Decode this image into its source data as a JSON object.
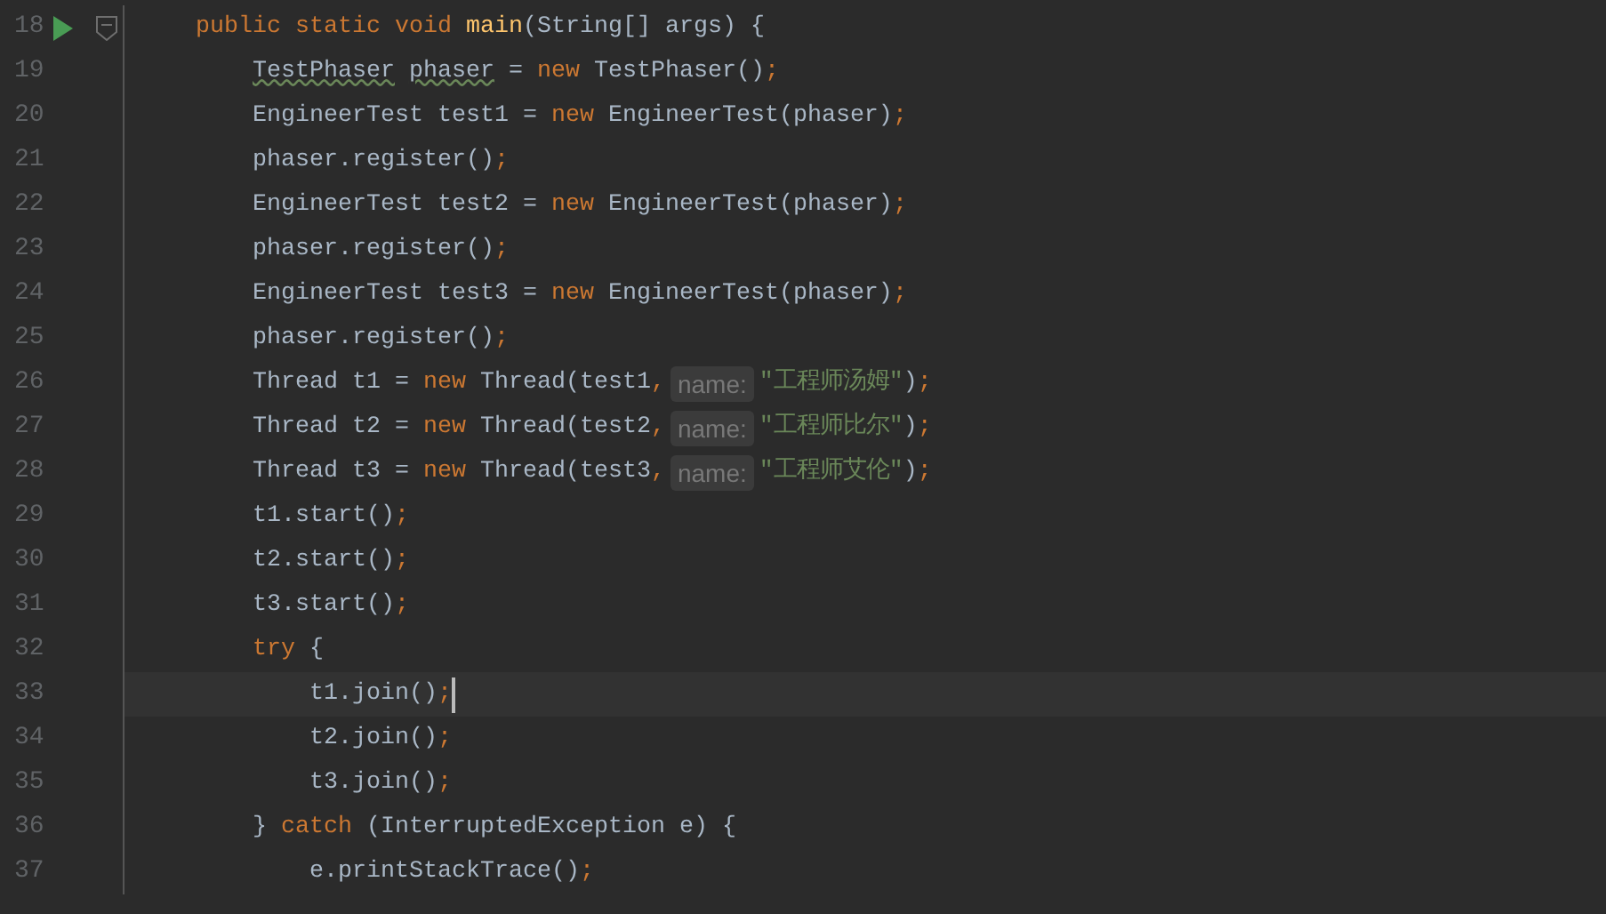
{
  "editor": {
    "lines": [
      {
        "number": "18",
        "run_marker": true,
        "fold_marker": true,
        "current": false,
        "tokens": [
          {
            "kind": "keyword",
            "text": "public static void "
          },
          {
            "kind": "method",
            "text": "main"
          },
          {
            "kind": "plain",
            "text": "(String[] args) {"
          }
        ],
        "children": [
          {
            "number": "19",
            "run_marker": false,
            "fold_marker": false,
            "current": false,
            "tokens": [
              {
                "kind": "warning",
                "text": "TestPhaser"
              },
              {
                "kind": "warning",
                "text": "phaser"
              },
              {
                "kind": "plain",
                "text": " = "
              },
              {
                "kind": "keyword",
                "text": "new "
              },
              {
                "kind": "plain",
                "text": "TestPhaser()"
              },
              {
                "kind": "punct",
                "text": ";"
              }
            ]
          },
          {
            "number": "20",
            "run_marker": false,
            "fold_marker": false,
            "current": false,
            "tokens": [
              {
                "kind": "plain",
                "text": "EngineerTest test1 = "
              },
              {
                "kind": "keyword",
                "text": "new "
              },
              {
                "kind": "plain",
                "text": "EngineerTest(phaser)"
              },
              {
                "kind": "punct",
                "text": ";"
              }
            ]
          },
          {
            "number": "21",
            "run_marker": false,
            "fold_marker": false,
            "current": false,
            "tokens": [
              {
                "kind": "plain",
                "text": "phaser.register()"
              },
              {
                "kind": "punct",
                "text": ";"
              }
            ]
          },
          {
            "number": "22",
            "run_marker": false,
            "fold_marker": false,
            "current": false,
            "tokens": [
              {
                "kind": "plain",
                "text": "EngineerTest test2 = "
              },
              {
                "kind": "keyword",
                "text": "new "
              },
              {
                "kind": "plain",
                "text": "EngineerTest(phaser)"
              },
              {
                "kind": "punct",
                "text": ";"
              }
            ]
          },
          {
            "number": "23",
            "run_marker": false,
            "fold_marker": false,
            "current": false,
            "tokens": [
              {
                "kind": "plain",
                "text": "phaser.register()"
              },
              {
                "kind": "punct",
                "text": ";"
              }
            ]
          },
          {
            "number": "24",
            "run_marker": false,
            "fold_marker": false,
            "current": false,
            "tokens": [
              {
                "kind": "plain",
                "text": "EngineerTest test3 = "
              },
              {
                "kind": "keyword",
                "text": "new "
              },
              {
                "kind": "plain",
                "text": "EngineerTest(phaser)"
              },
              {
                "kind": "punct",
                "text": ";"
              }
            ]
          },
          {
            "number": "25",
            "run_marker": false,
            "fold_marker": false,
            "current": false,
            "tokens": [
              {
                "kind": "plain",
                "text": "phaser.register()"
              },
              {
                "kind": "punct",
                "text": ";"
              }
            ]
          },
          {
            "number": "26",
            "run_marker": false,
            "fold_marker": false,
            "current": false,
            "tokens": [
              {
                "kind": "plain",
                "text": "Thread t1 = "
              },
              {
                "kind": "keyword",
                "text": "new "
              },
              {
                "kind": "plain",
                "text": "Thread(test1"
              },
              {
                "kind": "punct",
                "text": ","
              },
              {
                "kind": "hint",
                "text": "name:"
              },
              {
                "kind": "string",
                "text": "\"工程师汤姆\""
              },
              {
                "kind": "plain",
                "text": ")"
              },
              {
                "kind": "punct",
                "text": ";"
              }
            ]
          },
          {
            "number": "27",
            "run_marker": false,
            "fold_marker": false,
            "current": false,
            "tokens": [
              {
                "kind": "plain",
                "text": "Thread t2 = "
              },
              {
                "kind": "keyword",
                "text": "new "
              },
              {
                "kind": "plain",
                "text": "Thread(test2"
              },
              {
                "kind": "punct",
                "text": ","
              },
              {
                "kind": "hint",
                "text": "name:"
              },
              {
                "kind": "string",
                "text": "\"工程师比尔\""
              },
              {
                "kind": "plain",
                "text": ")"
              },
              {
                "kind": "punct",
                "text": ";"
              }
            ]
          },
          {
            "number": "28",
            "run_marker": false,
            "fold_marker": false,
            "current": false,
            "tokens": [
              {
                "kind": "plain",
                "text": "Thread t3 = "
              },
              {
                "kind": "keyword",
                "text": "new "
              },
              {
                "kind": "plain",
                "text": "Thread(test3"
              },
              {
                "kind": "punct",
                "text": ","
              },
              {
                "kind": "hint",
                "text": "name:"
              },
              {
                "kind": "string",
                "text": "\"工程师艾伦\""
              },
              {
                "kind": "plain",
                "text": ")"
              },
              {
                "kind": "punct",
                "text": ";"
              }
            ]
          },
          {
            "number": "29",
            "run_marker": false,
            "fold_marker": false,
            "current": false,
            "tokens": [
              {
                "kind": "plain",
                "text": "t1.start()"
              },
              {
                "kind": "punct",
                "text": ";"
              }
            ]
          },
          {
            "number": "30",
            "run_marker": false,
            "fold_marker": false,
            "current": false,
            "tokens": [
              {
                "kind": "plain",
                "text": "t2.start()"
              },
              {
                "kind": "punct",
                "text": ";"
              }
            ]
          },
          {
            "number": "31",
            "run_marker": false,
            "fold_marker": false,
            "current": false,
            "tokens": [
              {
                "kind": "plain",
                "text": "t3.start()"
              },
              {
                "kind": "punct",
                "text": ";"
              }
            ]
          },
          {
            "number": "32",
            "run_marker": false,
            "fold_marker": false,
            "current": false,
            "tokens": [
              {
                "kind": "keyword",
                "text": "try "
              },
              {
                "kind": "plain",
                "text": "{"
              }
            ],
            "children": [
              {
                "number": "33",
                "run_marker": false,
                "fold_marker": false,
                "current": true,
                "tokens": [
                  {
                    "kind": "plain",
                    "text": "t1.join()"
                  },
                  {
                    "kind": "punct",
                    "text": ";"
                  }
                ]
              },
              {
                "number": "34",
                "run_marker": false,
                "fold_marker": false,
                "current": false,
                "tokens": [
                  {
                    "kind": "plain",
                    "text": "t2.join()"
                  },
                  {
                    "kind": "punct",
                    "text": ";"
                  }
                ]
              },
              {
                "number": "35",
                "run_marker": false,
                "fold_marker": false,
                "current": false,
                "tokens": [
                  {
                    "kind": "plain",
                    "text": "t3.join()"
                  },
                  {
                    "kind": "punct",
                    "text": ";"
                  }
                ]
              }
            ]
          },
          {
            "number": "36",
            "run_marker": false,
            "fold_marker": false,
            "current": false,
            "tokens": [
              {
                "kind": "plain",
                "text": "} "
              },
              {
                "kind": "keyword",
                "text": "catch "
              },
              {
                "kind": "plain",
                "text": "(InterruptedException e) {"
              }
            ],
            "children": [
              {
                "number": "37",
                "run_marker": false,
                "fold_marker": false,
                "current": false,
                "tokens": [
                  {
                    "kind": "plain",
                    "text": "e.printStackTrace()"
                  },
                  {
                    "kind": "punct",
                    "text": ";"
                  }
                ]
              }
            ]
          }
        ]
      }
    ]
  }
}
